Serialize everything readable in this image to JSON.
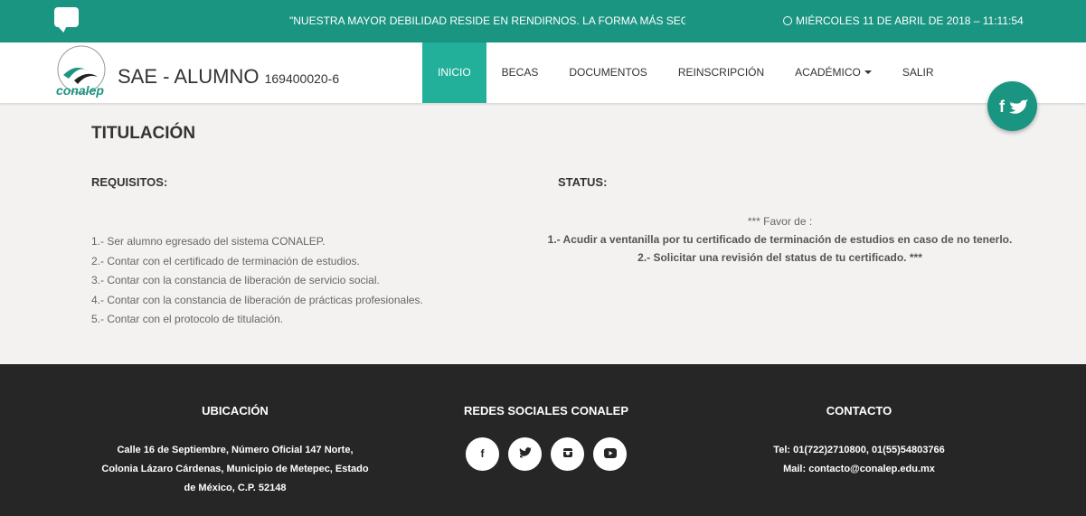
{
  "topbar": {
    "chat_icon": "chat-bubble-icon",
    "marquee": "\"NUESTRA MAYOR DEBILIDAD RESIDE EN RENDIRNOS. LA FORMA MÁS SEGURA",
    "datetime": "MIÉRCOLES 11 DE ABRIL DE 2018 – 11:11:54",
    "clock_icon": "clock-icon"
  },
  "header": {
    "logo_text": "conalep",
    "title": "SAE - ALUMNO",
    "student_id": "169400020-6"
  },
  "nav": {
    "items": [
      {
        "label": "INICIO",
        "active": true
      },
      {
        "label": "BECAS"
      },
      {
        "label": "DOCUMENTOS"
      },
      {
        "label": "REINSCRIPCIÓN"
      },
      {
        "label": "ACADÉMICO"
      },
      {
        "label": "SALIR"
      }
    ]
  },
  "social_fab": {
    "label": "f🐦"
  },
  "main": {
    "title": "TITULACIÓN",
    "requirements_title": "REQUISITOS:",
    "status_title": "STATUS:",
    "requirements": [
      "1.- Ser alumno egresado del sistema CONALEP.",
      "2.- Contar con el certificado de terminación de estudios.",
      "3.- Contar con la constancia de liberación de servicio social.",
      "4.- Contar con la constancia de liberación de prácticas profesionales.",
      "5.- Contar con el protocolo de titulación."
    ],
    "status_lines": [
      "*** Favor de :",
      "1.- Acudir a ventanilla por tu certificado de terminación de estudios en caso de no tenerlo.",
      "2.- Solicitar una revisión del status de tu certificado. ***"
    ]
  },
  "footer": {
    "location_title": "UBICACIÓN",
    "location_lines": [
      "Calle 16 de Septiembre, Número Oficial 147 Norte,",
      "Colonia Lázaro Cárdenas, Municipio de Metepec, Estado",
      "de México, C.P. 52148"
    ],
    "social_title": "REDES SOCIALES CONALEP",
    "social_icons": [
      "facebook-icon",
      "twitter-icon",
      "instagram-icon",
      "youtube-icon"
    ],
    "contact_title": "CONTACTO",
    "contact_lines": [
      "Tel: 01(722)2710800, 01(55)54803766",
      "Mail: contacto@conalep.edu.mx"
    ]
  },
  "colors": {
    "primary": "#1a9581",
    "active": "#23b09b",
    "footer": "#262626"
  }
}
